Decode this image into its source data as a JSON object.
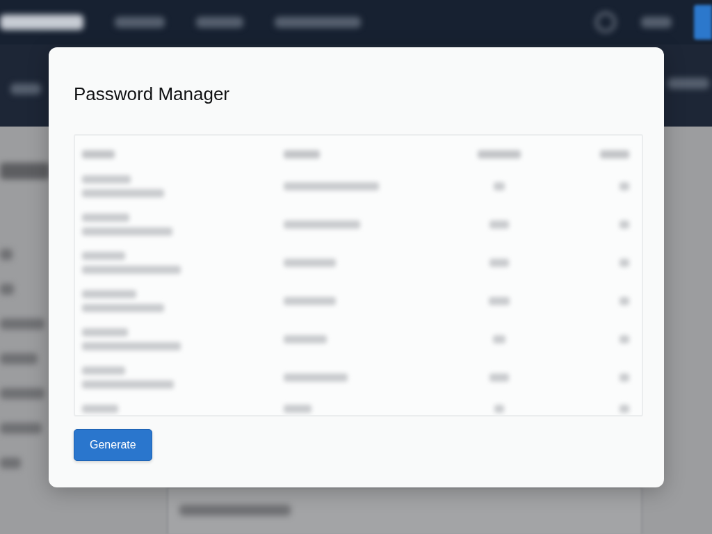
{
  "backdrop": {
    "kind": "blurred"
  },
  "dialog": {
    "title": "Password Manager",
    "table": {
      "kind": "blurred",
      "rows": [
        {
          "kind": "header"
        },
        {
          "kind": "entry"
        },
        {
          "kind": "entry"
        },
        {
          "kind": "entry"
        },
        {
          "kind": "entry"
        },
        {
          "kind": "entry"
        },
        {
          "kind": "entry"
        },
        {
          "kind": "partial"
        }
      ]
    },
    "buttons": [
      {
        "label": "Generate",
        "kind": "primary"
      }
    ]
  }
}
